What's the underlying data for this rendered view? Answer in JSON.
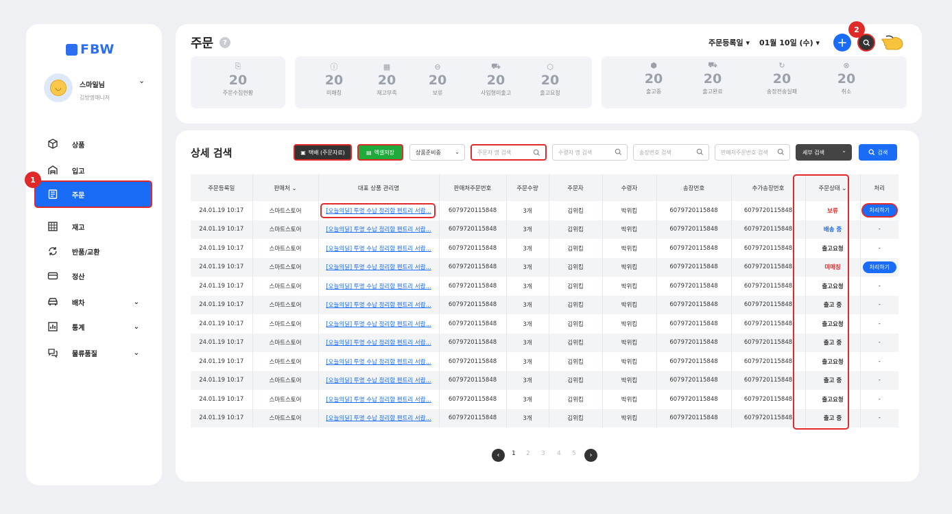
{
  "brand": {
    "logo_text": "FBW"
  },
  "profile": {
    "name": "스마일님",
    "role": "김방명매니저"
  },
  "nav": [
    {
      "label": "상품",
      "icon": "box-icon"
    },
    {
      "label": "입고",
      "icon": "warehouse-icon"
    },
    {
      "label": "주문",
      "icon": "order-icon",
      "active": true
    },
    {
      "label": "재고",
      "icon": "grid-icon"
    },
    {
      "label": "반품/교환",
      "icon": "exchange-icon"
    },
    {
      "label": "정산",
      "icon": "card-icon"
    },
    {
      "label": "배차",
      "icon": "car-icon",
      "expand": true
    },
    {
      "label": "통계",
      "icon": "chart-icon",
      "expand": true
    },
    {
      "label": "물류품질",
      "icon": "chat-icon",
      "expand": true
    }
  ],
  "badges": {
    "one": "1",
    "two": "2"
  },
  "header": {
    "title": "주문",
    "date_type": "주문등록일",
    "date": "01월 10일 (수)"
  },
  "stats": {
    "g1": [
      {
        "value": "20",
        "label": "주문수집현황"
      }
    ],
    "g2": [
      {
        "value": "20",
        "label": "미매칭"
      },
      {
        "value": "20",
        "label": "재고부족"
      },
      {
        "value": "20",
        "label": "보류"
      },
      {
        "value": "20",
        "label": "사입형미출고"
      },
      {
        "value": "20",
        "label": "출고요청"
      }
    ],
    "g3": [
      {
        "value": "20",
        "label": "출고중"
      },
      {
        "value": "20",
        "label": "출고완료"
      },
      {
        "value": "20",
        "label": "송장전송실패"
      },
      {
        "value": "20",
        "label": "취소"
      }
    ]
  },
  "search": {
    "title": "상세 검색",
    "btn_courier": "택배 (주문자료)",
    "btn_excel": "엑셀저장",
    "select_status": "상품준비중",
    "ph_orderer": "주문자 명 검색",
    "ph_receiver": "수령자 명 검색",
    "ph_invoice": "송장번호 검색",
    "ph_seller_order": "판매처주문번호 검색",
    "btn_detail": "세부 검색",
    "btn_search": "검색"
  },
  "table": {
    "headers": [
      "주문등록일",
      "판매처",
      "대표 상품 관리명",
      "판매처주문번호",
      "주문수량",
      "주문자",
      "수령자",
      "송장번호",
      "추가송장번호",
      "주문상태",
      "처리"
    ],
    "rows": [
      {
        "date": "24.01.19 10:17",
        "seller": "스마트스토어",
        "product": "[오늘의딜] 투명 수납 정리함 펜트리 서랍...",
        "order_no": "6079720115848",
        "qty": "3개",
        "orderer": "김위킴",
        "receiver": "박위킴",
        "invoice": "6079720115848",
        "extra_invoice": "6079720115848",
        "status": "보류",
        "status_type": "red",
        "action": "처리하기"
      },
      {
        "date": "24.01.19 10:17",
        "seller": "스마트스토어",
        "product": "[오늘의딜] 투명 수납 정리함 펜트리 서랍...",
        "order_no": "6079720115848",
        "qty": "3개",
        "orderer": "김위킴",
        "receiver": "박위킴",
        "invoice": "6079720115848",
        "extra_invoice": "6079720115848",
        "status": "배송 중",
        "status_type": "blue",
        "action": "-"
      },
      {
        "date": "24.01.19 10:17",
        "seller": "스마트스토어",
        "product": "[오늘의딜] 투명 수납 정리함 펜트리 서랍...",
        "order_no": "6079720115848",
        "qty": "3개",
        "orderer": "김위킴",
        "receiver": "박위킴",
        "invoice": "6079720115848",
        "extra_invoice": "6079720115848",
        "status": "출고요청",
        "status_type": "dark",
        "action": "-"
      },
      {
        "date": "24.01.19 10:17",
        "seller": "스마트스토어",
        "product": "[오늘의딜] 투명 수납 정리함 펜트리 서랍...",
        "order_no": "6079720115848",
        "qty": "3개",
        "orderer": "김위킴",
        "receiver": "박위킴",
        "invoice": "6079720115848",
        "extra_invoice": "6079720115848",
        "status": "미매칭",
        "status_type": "red",
        "action": "처리하기"
      },
      {
        "date": "24.01.19 10:17",
        "seller": "스마트스토어",
        "product": "[오늘의딜] 투명 수납 정리함 펜트리 서랍...",
        "order_no": "6079720115848",
        "qty": "3개",
        "orderer": "김위킴",
        "receiver": "박위킴",
        "invoice": "6079720115848",
        "extra_invoice": "6079720115848",
        "status": "출고요청",
        "status_type": "dark",
        "action": "-"
      },
      {
        "date": "24.01.19 10:17",
        "seller": "스마트스토어",
        "product": "[오늘의딜] 투명 수납 정리함 펜트리 서랍...",
        "order_no": "6079720115848",
        "qty": "3개",
        "orderer": "김위킴",
        "receiver": "박위킴",
        "invoice": "6079720115848",
        "extra_invoice": "6079720115848",
        "status": "출고 중",
        "status_type": "dark",
        "action": "-"
      },
      {
        "date": "24.01.19 10:17",
        "seller": "스마트스토어",
        "product": "[오늘의딜] 투명 수납 정리함 펜트리 서랍...",
        "order_no": "6079720115848",
        "qty": "3개",
        "orderer": "김위킴",
        "receiver": "박위킴",
        "invoice": "6079720115848",
        "extra_invoice": "6079720115848",
        "status": "출고요청",
        "status_type": "dark",
        "action": "-"
      },
      {
        "date": "24.01.19 10:17",
        "seller": "스마트스토어",
        "product": "[오늘의딜] 투명 수납 정리함 펜트리 서랍...",
        "order_no": "6079720115848",
        "qty": "3개",
        "orderer": "김위킴",
        "receiver": "박위킴",
        "invoice": "6079720115848",
        "extra_invoice": "6079720115848",
        "status": "출고 중",
        "status_type": "dark",
        "action": "-"
      },
      {
        "date": "24.01.19 10:17",
        "seller": "스마트스토어",
        "product": "[오늘의딜] 투명 수납 정리함 펜트리 서랍...",
        "order_no": "6079720115848",
        "qty": "3개",
        "orderer": "김위킴",
        "receiver": "박위킴",
        "invoice": "6079720115848",
        "extra_invoice": "6079720115848",
        "status": "출고요청",
        "status_type": "dark",
        "action": "-"
      },
      {
        "date": "24.01.19 10:17",
        "seller": "스마트스토어",
        "product": "[오늘의딜] 투명 수납 정리함 펜트리 서랍...",
        "order_no": "6079720115848",
        "qty": "3개",
        "orderer": "김위킴",
        "receiver": "박위킴",
        "invoice": "6079720115848",
        "extra_invoice": "6079720115848",
        "status": "출고 중",
        "status_type": "dark",
        "action": "-"
      },
      {
        "date": "24.01.19 10:17",
        "seller": "스마트스토어",
        "product": "[오늘의딜] 투명 수납 정리함 펜트리 서랍...",
        "order_no": "6079720115848",
        "qty": "3개",
        "orderer": "김위킴",
        "receiver": "박위킴",
        "invoice": "6079720115848",
        "extra_invoice": "6079720115848",
        "status": "출고요청",
        "status_type": "dark",
        "action": "-"
      },
      {
        "date": "24.01.19 10:17",
        "seller": "스마트스토어",
        "product": "[오늘의딜] 투명 수납 정리함 펜트리 서랍...",
        "order_no": "6079720115848",
        "qty": "3개",
        "orderer": "김위킴",
        "receiver": "박위킴",
        "invoice": "6079720115848",
        "extra_invoice": "6079720115848",
        "status": "출고 중",
        "status_type": "dark",
        "action": "-"
      }
    ]
  },
  "pagination": {
    "pages": [
      "1",
      "2",
      "3",
      "4",
      "5"
    ],
    "current": "1"
  },
  "colors": {
    "accent": "#1a6bf5",
    "highlight": "#e02a2a",
    "excel": "#1faa3c",
    "dark": "#333333"
  }
}
